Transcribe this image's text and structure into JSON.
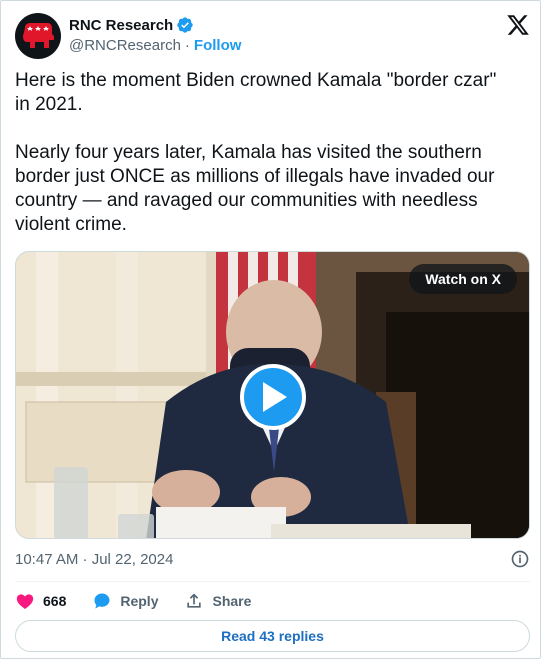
{
  "author": {
    "name": "RNC Research",
    "handle": "@RNCResearch",
    "separator": "·",
    "follow_label": "Follow"
  },
  "tweet": {
    "text": "Here is the moment Biden crowned Kamala \"border czar\"\nin 2021.\n\nNearly four years later, Kamala has visited the southern\nborder just ONCE as millions of illegals have invaded our\ncountry — and ravaged our communities with needless\nviolent crime.",
    "timestamp": "10:47 AM · Jul 22, 2024"
  },
  "media": {
    "watch_label": "Watch on X"
  },
  "actions": {
    "likes_count": "668",
    "reply_label": "Reply",
    "share_label": "Share"
  },
  "replies": {
    "label": "Read 43 replies"
  },
  "colors": {
    "accent": "#1d9bf0",
    "heart": "#f91880",
    "text": "#0f1419",
    "muted": "#536471"
  }
}
